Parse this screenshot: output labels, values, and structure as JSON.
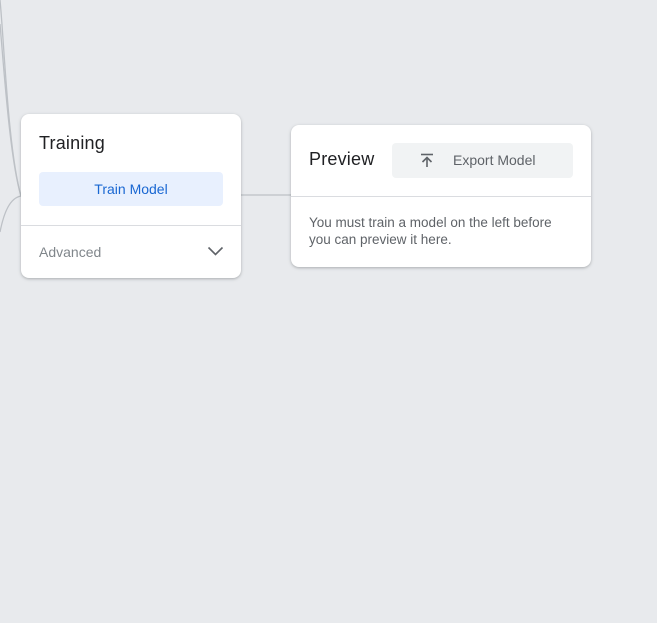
{
  "training": {
    "title": "Training",
    "train_button_label": "Train Model",
    "advanced_label": "Advanced",
    "advanced_icon": "chevron-down-icon"
  },
  "preview": {
    "title": "Preview",
    "export_button_label": "Export Model",
    "export_icon": "export-upload-icon",
    "message": "You must train a model on the left before you can preview it here."
  },
  "colors": {
    "canvas_background": "#e8eaed",
    "card_background": "#ffffff",
    "primary_button_bg": "#e8f0fe",
    "primary_button_text": "#1967d2",
    "secondary_button_bg": "#f1f3f4",
    "connector_line": "#bdc1c6"
  }
}
